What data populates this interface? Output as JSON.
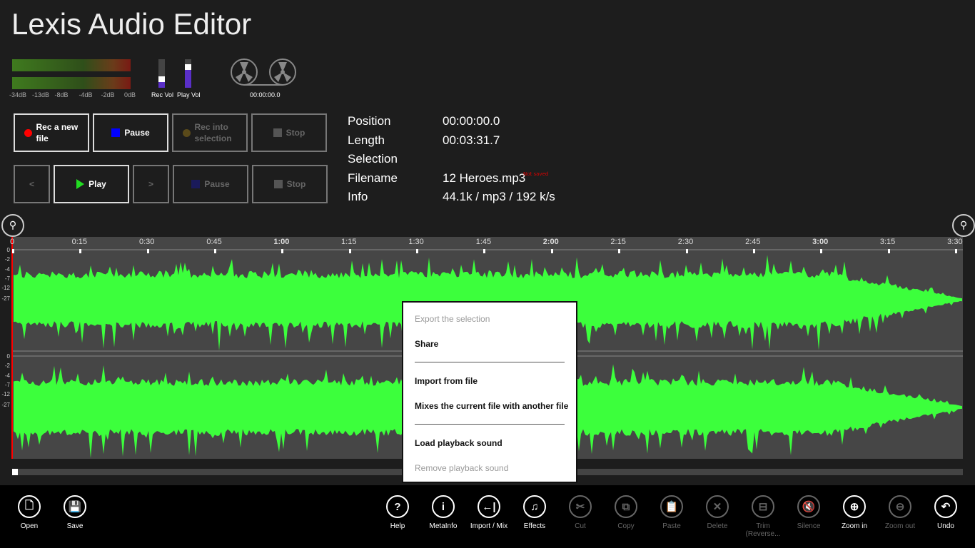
{
  "app": {
    "title": "Lexis Audio Editor"
  },
  "meters": {
    "db_labels": [
      "-34dB",
      "-13dB",
      "-8dB",
      "-4dB",
      "-2dB",
      "0dB"
    ],
    "rec_vol_label": "Rec Vol",
    "play_vol_label": "Play Vol",
    "rec_vol_level": 0.3,
    "play_vol_level": 0.72,
    "tape_time": "00:00:00.0"
  },
  "record_buttons": {
    "rec_new": "Rec a new file",
    "pause": "Pause",
    "rec_into": "Rec into selection",
    "stop": "Stop"
  },
  "play_buttons": {
    "prev": "<",
    "play": "Play",
    "next": ">",
    "pause": "Pause",
    "stop": "Stop"
  },
  "info": {
    "position_label": "Position",
    "position": "00:00:00.0",
    "length_label": "Length",
    "length": "00:03:31.7",
    "selection_label": "Selection",
    "selection": "",
    "filename_label": "Filename",
    "filename": "12 Heroes.mp3",
    "not_saved": "Not saved",
    "info_label": "Info",
    "info": "44.1k / mp3 / 192 k/s"
  },
  "timeline": {
    "ticks": [
      "0",
      "0:15",
      "0:30",
      "0:45",
      "1:00",
      "1:15",
      "1:30",
      "1:45",
      "2:00",
      "2:15",
      "2:30",
      "2:45",
      "3:00",
      "3:15",
      "3:30"
    ],
    "db_scale": [
      "0",
      "-2",
      "-4",
      "-7",
      "-12",
      "-27"
    ]
  },
  "colors": {
    "waveform": "#3cff3c",
    "cursor": "#ff0000",
    "accent": "#5a2fc8"
  },
  "context_menu": {
    "items": [
      {
        "label": "Export the selection",
        "enabled": false
      },
      {
        "label": "Share",
        "enabled": true
      },
      {
        "label": "Import from file",
        "enabled": true
      },
      {
        "label": "Mixes the current file with another file",
        "enabled": true
      },
      {
        "label": "Load playback sound",
        "enabled": true
      },
      {
        "label": "Remove playback sound",
        "enabled": false
      }
    ]
  },
  "appbar": {
    "left": [
      {
        "label": "Open",
        "icon": "open-file-icon",
        "glyph": "🗋"
      },
      {
        "label": "Save",
        "icon": "save-icon",
        "glyph": "💾"
      }
    ],
    "right": [
      {
        "label": "Help",
        "icon": "help-icon",
        "glyph": "?",
        "enabled": true
      },
      {
        "label": "MetaInfo",
        "icon": "info-icon",
        "glyph": "i",
        "enabled": true
      },
      {
        "label": "Import / Mix",
        "icon": "import-icon",
        "glyph": "←|",
        "enabled": true
      },
      {
        "label": "Effects",
        "icon": "effects-icon",
        "glyph": "♫",
        "enabled": true
      },
      {
        "label": "Cut",
        "icon": "scissors-icon",
        "glyph": "✂",
        "enabled": false
      },
      {
        "label": "Copy",
        "icon": "copy-icon",
        "glyph": "⧉",
        "enabled": false
      },
      {
        "label": "Paste",
        "icon": "paste-icon",
        "glyph": "📋",
        "enabled": false
      },
      {
        "label": "Delete",
        "icon": "delete-icon",
        "glyph": "✕",
        "enabled": false
      },
      {
        "label": "Trim (Reverse...",
        "icon": "trim-icon",
        "glyph": "⊟",
        "enabled": false
      },
      {
        "label": "Silence",
        "icon": "mute-icon",
        "glyph": "🔇",
        "enabled": false
      },
      {
        "label": "Zoom in",
        "icon": "zoom-in-icon",
        "glyph": "⊕",
        "enabled": true
      },
      {
        "label": "Zoom out",
        "icon": "zoom-out-icon",
        "glyph": "⊖",
        "enabled": false
      },
      {
        "label": "Undo",
        "icon": "undo-icon",
        "glyph": "↶",
        "enabled": true
      }
    ]
  }
}
